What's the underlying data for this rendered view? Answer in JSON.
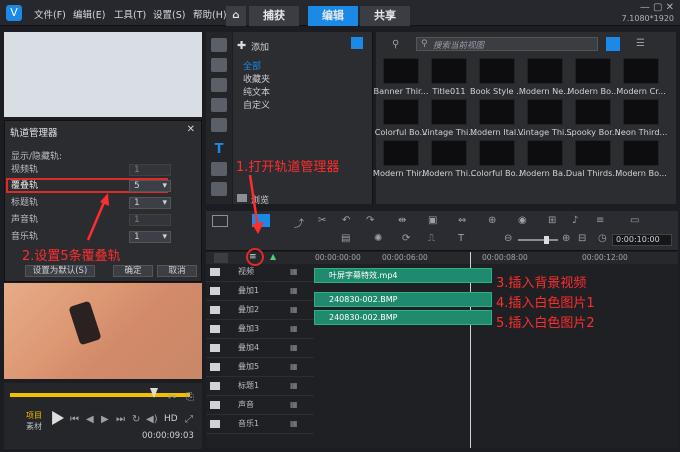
{
  "menu": {
    "file": "文件(F)",
    "edit": "编辑(E)",
    "tools": "工具(T)",
    "settings": "设置(S)",
    "help": "帮助(H)"
  },
  "tabs": [
    "捕获",
    "编辑",
    "共享"
  ],
  "active_tab": "编辑",
  "window_info": "7.1080*1920",
  "track_manager": {
    "title": "轨道管理器",
    "section": "显示/隐藏轨:",
    "rows": [
      {
        "label": "视频轨",
        "value": "1"
      },
      {
        "label": "覆叠轨",
        "value": "5"
      },
      {
        "label": "标题轨",
        "value": "1"
      },
      {
        "label": "声音轨",
        "value": "1"
      },
      {
        "label": "音乐轨",
        "value": "1"
      }
    ],
    "btn_default": "设置为默认(S)",
    "btn_ok": "确定",
    "btn_cancel": "取消"
  },
  "library": {
    "add_label": "添加",
    "categories": [
      "全部",
      "收藏夹",
      "纯文本",
      "自定义"
    ],
    "browse_label": "浏览",
    "search_placeholder": "搜索当前视图"
  },
  "thumbnails": [
    "Banner Thir...",
    "Title011",
    "Book Style ...",
    "Modern Ne...",
    "Modern Bo...",
    "Modern Cr...",
    "Colorful Bo...",
    "Vintage Thi...",
    "Modern Ital...",
    "Vintage Thi...",
    "Spooky Bor...",
    "Neon Third...",
    "Modern Thir...",
    "Modern Thi...",
    "Colorful Bo...",
    "Modern Ba...",
    "Dual Thirds...",
    "Modern Bo..."
  ],
  "timeline": {
    "times": [
      "00:00:00:00",
      "00:00:06:00",
      "00:00:08:00",
      "00:00:12:00"
    ],
    "timecode": "0:00:10:00",
    "tracks": [
      "视频",
      "叠加1",
      "叠加2",
      "叠加3",
      "叠加4",
      "叠加5",
      "标题1",
      "声音",
      "音乐1"
    ],
    "clips": [
      "叶屏字幕特效.mp4",
      "240830-002.BMP",
      "240830-002.BMP"
    ]
  },
  "player": {
    "project_label": "项目",
    "clip_label": "素材",
    "hd_label": "HD",
    "timecode": "00:00:09:03"
  },
  "annotations": [
    "1.打开轨道管理器",
    "2.设置5条覆叠轨",
    "3.插入背景视频",
    "4.插入白色图片1",
    "5.插入白色图片2"
  ],
  "colors": {
    "accent": "#1a8ae6",
    "annotation": "#ff2d2d",
    "clip": "#1f8a6e"
  }
}
